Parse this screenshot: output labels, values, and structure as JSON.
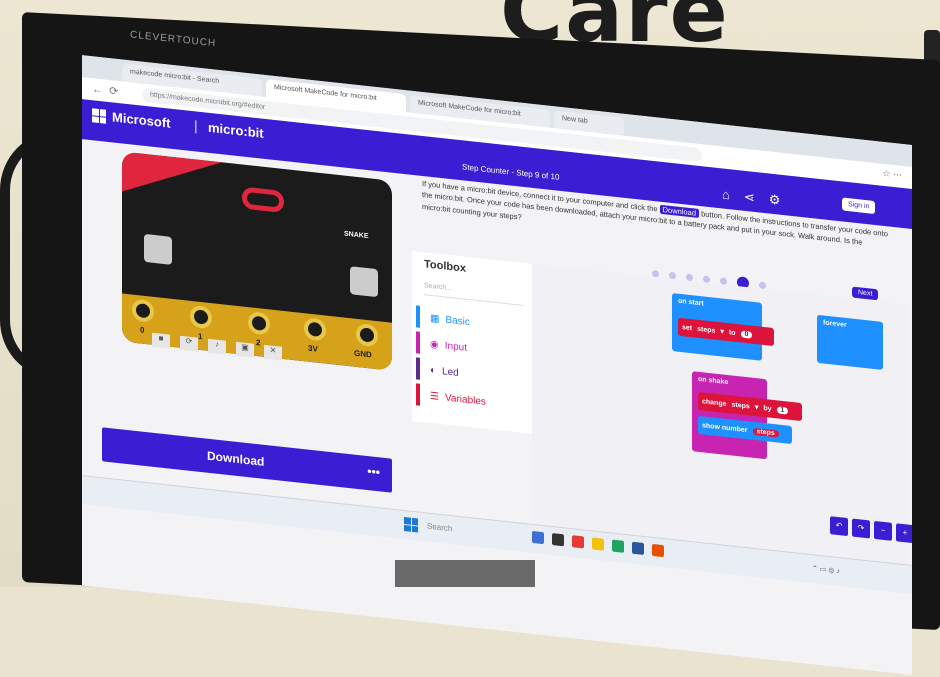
{
  "monitor": {
    "brand": "CLEVERTOUCH"
  },
  "wall": {
    "text": "Care"
  },
  "browser": {
    "tabs": [
      "makecode micro:bit - Search",
      "Microsoft MakeCode for micro:bit",
      "Microsoft MakeCode for micro:bit",
      "New tab"
    ],
    "url": "https://makecode.microbit.org/#editor"
  },
  "header": {
    "brand": "Microsoft",
    "product": "micro:bit",
    "step_title": "Step Counter - Step 9 of 10",
    "signin": "Sign in"
  },
  "simulator": {
    "badge": "SNAKE",
    "pins": [
      "0",
      "1",
      "2",
      "3V",
      "GND"
    ]
  },
  "download": {
    "label": "Download",
    "more": "•••"
  },
  "instructions": {
    "p1": "If you have a micro:bit device, connect it to your computer and click the",
    "download_word": "Download",
    "p2": "button. Follow the instructions to transfer your code onto the micro:bit. Once your code has been downloaded, attach your micro:bit to a battery pack and put in your sock. Walk around. Is the micro:bit counting your steps?"
  },
  "next_label": "Next",
  "toolbox": {
    "title": "Toolbox",
    "search_placeholder": "Search...",
    "items": [
      {
        "label": "Basic",
        "color": "#1e90ff"
      },
      {
        "label": "Input",
        "color": "#c724b1"
      },
      {
        "label": "Led",
        "color": "#5c2d91"
      },
      {
        "label": "Variables",
        "color": "#dc143c"
      }
    ]
  },
  "blocks": {
    "on_start": "on start",
    "set": "set",
    "steps": "steps",
    "to": "to",
    "zero": "0",
    "forever": "forever",
    "on_shake": "on shake",
    "change": "change",
    "by": "by",
    "one": "1",
    "show_number": "show number"
  },
  "taskbar": {
    "search": "Search"
  }
}
